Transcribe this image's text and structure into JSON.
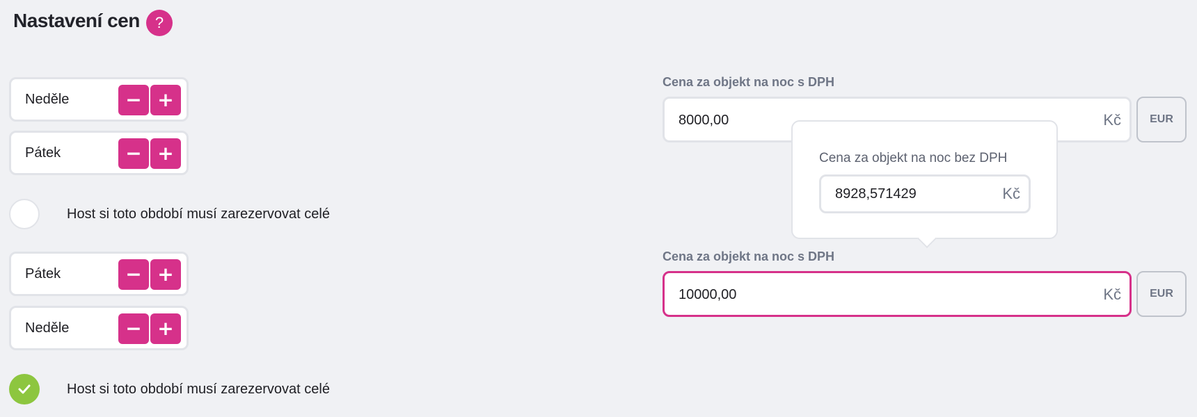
{
  "header": {
    "title": "Nastavení cen",
    "help_icon": "?"
  },
  "stepper": {
    "minus": "−",
    "plus": "+"
  },
  "period1": {
    "start_day": "Neděle",
    "end_day": "Pátek",
    "must_book_whole": false,
    "must_book_whole_label": "Host si toto období musí zarezervovat celé"
  },
  "period2": {
    "start_day": "Pátek",
    "end_day": "Neděle",
    "must_book_whole": true,
    "must_book_whole_label": "Host si toto období musí zarezervovat celé"
  },
  "price1": {
    "label": "Cena za objekt na noc s DPH",
    "value": "8000,00",
    "currency": "Kč",
    "eur_button": "EUR"
  },
  "popover": {
    "label": "Cena za objekt na noc bez DPH",
    "value": "8928,571429",
    "currency": "Kč"
  },
  "price2": {
    "label": "Cena za objekt na noc s DPH",
    "value": "10000,00",
    "currency": "Kč",
    "eur_button": "EUR"
  },
  "colors": {
    "accent": "#d6318a",
    "success": "#8dc63f",
    "background": "#f0f1f4"
  }
}
